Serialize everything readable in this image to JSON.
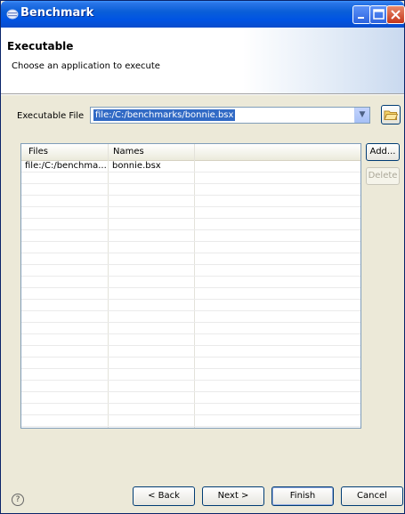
{
  "window": {
    "title": "Benchmark"
  },
  "header": {
    "title": "Executable",
    "description": "Choose an application to execute"
  },
  "executable": {
    "label": "Executable File",
    "value": "file:/C:/benchmarks/bonnie.bsx"
  },
  "table": {
    "columns": [
      "Files",
      "Names"
    ],
    "rows": [
      {
        "file": "file:/C:/benchma...",
        "name": "bonnie.bsx"
      }
    ]
  },
  "side_buttons": {
    "add": "Add...",
    "delete": "Delete"
  },
  "footer": {
    "back": "< Back",
    "next": "Next >",
    "finish": "Finish",
    "cancel": "Cancel",
    "help": "?"
  }
}
